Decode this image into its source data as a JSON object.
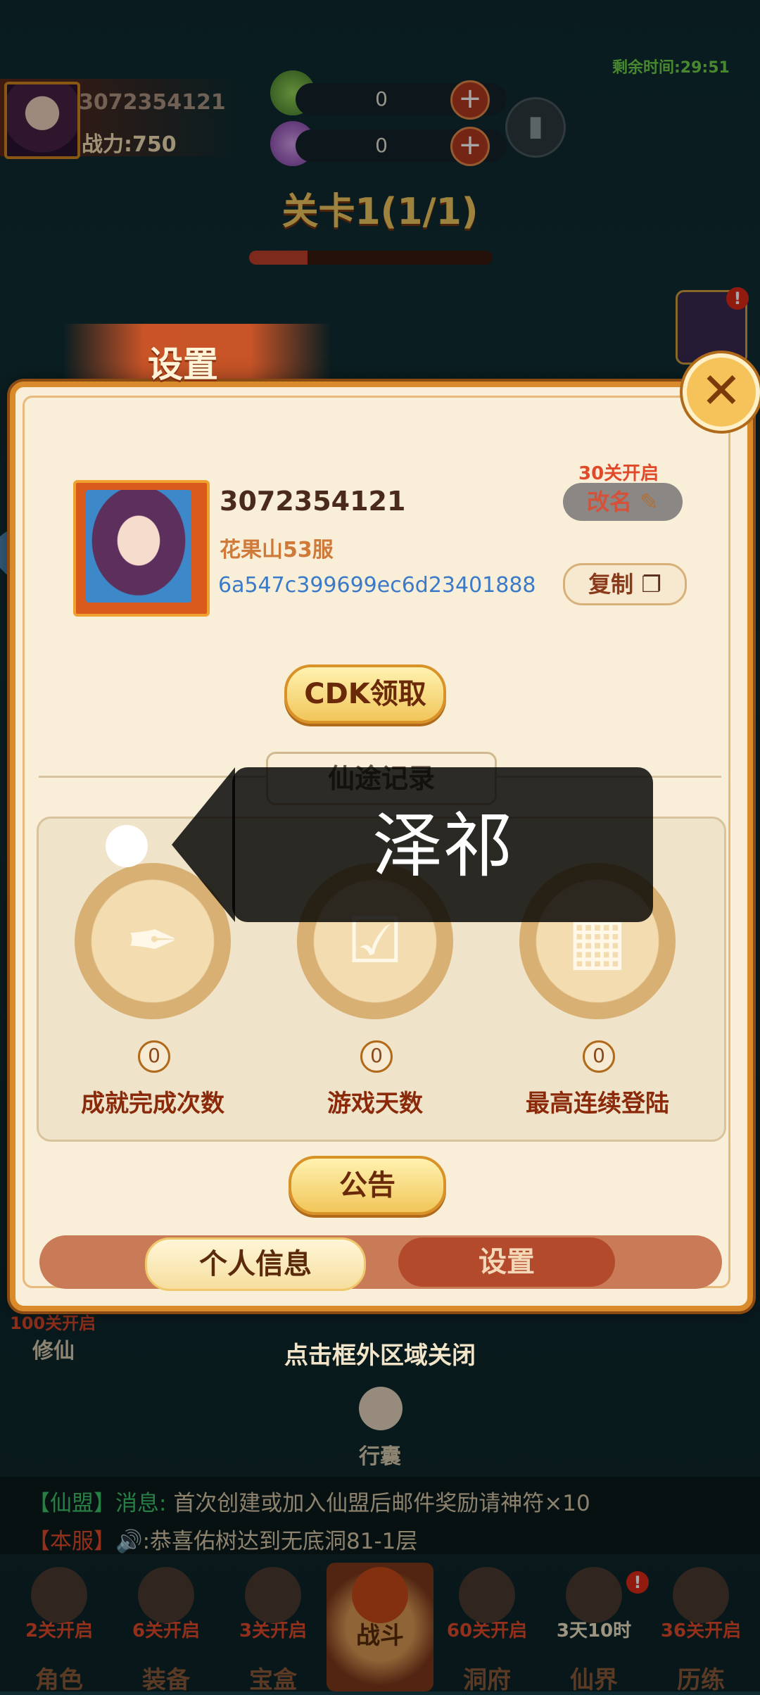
{
  "hud": {
    "timer": "剩余时间:29:51",
    "player_id": "3072354121",
    "power": "战力:750",
    "currency1_value": "0",
    "currency2_value": "0",
    "plus_label": "+",
    "level_title": "关卡1(1/1)",
    "level_progress": 0.24
  },
  "modal": {
    "title": "设置",
    "close_label": "✕",
    "player_uid": "3072354121",
    "server": "花果山53服",
    "account_hash": "6a547c399699ec6d23401888",
    "rename_unlock": "30关开启",
    "rename_label": "改名",
    "copy_label": "复制",
    "cdk_label": "CDK领取",
    "section_title": "仙途记录",
    "stats": [
      {
        "value": "0",
        "label": "成就完成次数",
        "icon": "achievement-scroll-icon"
      },
      {
        "value": "0",
        "label": "游戏天数",
        "icon": "calendar-check-icon"
      },
      {
        "value": "0",
        "label": "最高连续登陆",
        "icon": "login-streak-icon"
      }
    ],
    "notice_label": "公告",
    "tab_personal": "个人信息",
    "tab_settings": "设置",
    "close_hint": "点击框外区域关闭"
  },
  "toast": {
    "text": "泽祁"
  },
  "side": {
    "cultivate_unlock": "100关开启",
    "cultivate_label": "修仙",
    "bag_label": "行囊"
  },
  "chat": {
    "line1_channel": "【仙盟】",
    "line1_tag": "消息:",
    "line1_text": "首次创建或加入仙盟后邮件奖励请神符×10",
    "line2_channel": "【本服】",
    "line2_text": "🔊:恭喜佑树达到无底洞81-1层"
  },
  "nav": [
    {
      "unlock": "2关开启",
      "label": "角色",
      "icon": "character-icon"
    },
    {
      "unlock": "6关开启",
      "label": "装备",
      "icon": "equipment-icon"
    },
    {
      "unlock": "3关开启",
      "label": "宝盒",
      "icon": "treasure-box-icon"
    },
    {
      "unlock": "",
      "label": "战斗",
      "icon": "crossed-swords-icon"
    },
    {
      "unlock": "60关开启",
      "label": "洞府",
      "icon": "cave-house-icon"
    },
    {
      "unlock": "3天10时",
      "label": "仙界",
      "icon": "immortal-realm-icon"
    },
    {
      "unlock": "36关开启",
      "label": "历练",
      "icon": "training-icon"
    }
  ],
  "colors": {
    "accent_gold": "#f1c65a",
    "modal_bg": "#f9efd9",
    "unlock_red": "#e04a2a",
    "link_blue": "#3a7ac8"
  }
}
